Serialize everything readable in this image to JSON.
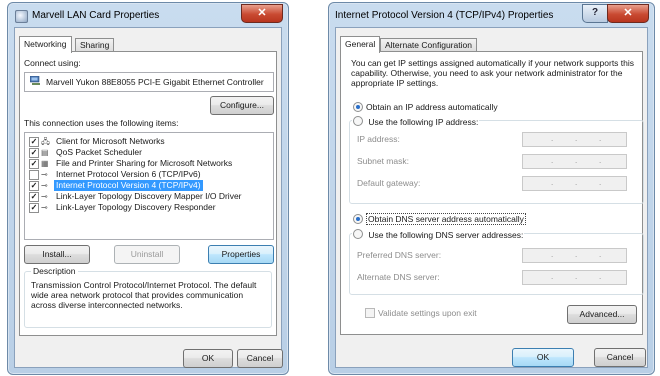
{
  "lan_window": {
    "title": "Marvell LAN Card Properties",
    "close_glyph": "✕",
    "tabs": [
      "Networking",
      "Sharing"
    ],
    "connect_using_label": "Connect using:",
    "adapter_name": "Marvell Yukon 88E8055 PCI-E Gigabit Ethernet Controller",
    "configure_label": "Configure...",
    "items_label": "This connection uses the following items:",
    "items": [
      {
        "label": "Client for Microsoft Networks",
        "checked": "✓",
        "icon": "network-client-icon"
      },
      {
        "label": "QoS Packet Scheduler",
        "checked": "✓",
        "icon": "qos-icon"
      },
      {
        "label": "File and Printer Sharing for Microsoft Networks",
        "checked": "✓",
        "icon": "printer-icon"
      },
      {
        "label": "Internet Protocol Version 6 (TCP/IPv6)",
        "checked": "",
        "icon": "protocol-icon"
      },
      {
        "label": "Internet Protocol Version 4 (TCP/IPv4)",
        "checked": "✓",
        "icon": "protocol-icon"
      },
      {
        "label": "Link-Layer Topology Discovery Mapper I/O Driver",
        "checked": "✓",
        "icon": "protocol-icon"
      },
      {
        "label": "Link-Layer Topology Discovery Responder",
        "checked": "✓",
        "icon": "protocol-icon"
      }
    ],
    "install_label": "Install...",
    "uninstall_label": "Uninstall",
    "properties_label": "Properties",
    "description_legend": "Description",
    "description_text": "Transmission Control Protocol/Internet Protocol. The default wide area network protocol that provides communication across diverse interconnected networks.",
    "ok_label": "OK",
    "cancel_label": "Cancel"
  },
  "ipv4_window": {
    "title": "Internet Protocol Version 4 (TCP/IPv4) Properties",
    "help_glyph": "?",
    "close_glyph": "✕",
    "tabs": [
      "General",
      "Alternate Configuration"
    ],
    "intro_text": "You can get IP settings assigned automatically if your network supports this capability. Otherwise, you need to ask your network administrator for the appropriate IP settings.",
    "obtain_ip_auto": "Obtain an IP address automatically",
    "use_following_ip": "Use the following IP address:",
    "ip_address_label": "IP address:",
    "subnet_mask_label": "Subnet mask:",
    "default_gateway_label": "Default gateway:",
    "obtain_dns_auto": "Obtain DNS server address automatically",
    "use_following_dns": "Use the following DNS server addresses:",
    "preferred_dns_label": "Preferred DNS server:",
    "alternate_dns_label": "Alternate DNS server:",
    "validate_label": "Validate settings upon exit",
    "advanced_label": "Advanced...",
    "ok_label": "OK",
    "cancel_label": "Cancel",
    "ip_dots": "."
  },
  "colors": {
    "selection": "#3399ff",
    "radio_dot": "#2a6fc9",
    "close_button": "#c94a32"
  }
}
